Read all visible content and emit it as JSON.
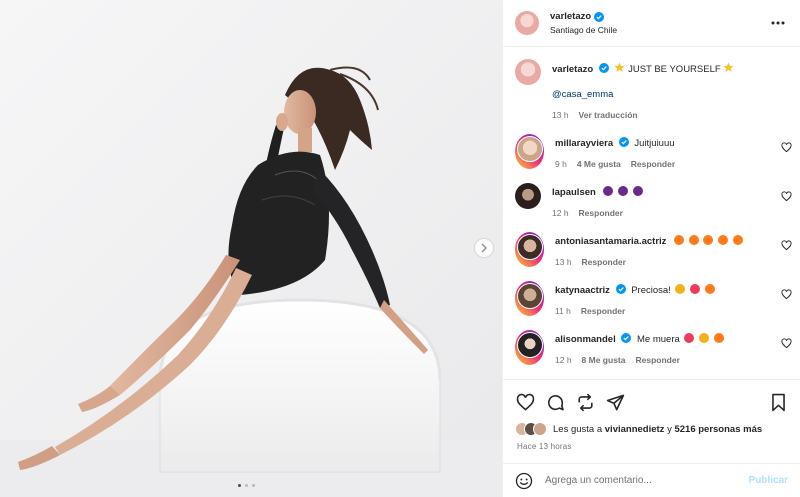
{
  "post": {
    "author": "varletazo",
    "location": "Santiago de Chile",
    "caption_text": "JUST BE YOURSELF",
    "mention": "@casa_emma",
    "caption_time": "13 h",
    "translate": "Ver traducción",
    "carousel": {
      "total": 3,
      "current": 1
    }
  },
  "comments": [
    {
      "user": "millarayviera",
      "verified": true,
      "text": "Juitjuiuuu",
      "time": "9 h",
      "likes": "4 Me gusta",
      "reply": "Responder",
      "avatar_color": "#e8c7a9"
    },
    {
      "user": "lapaulsen",
      "verified": false,
      "text": "",
      "emojis": [
        "eggplant",
        "eggplant",
        "eggplant"
      ],
      "time": "12 h",
      "likes": "",
      "reply": "Responder",
      "avatar_color": "#3b2b26"
    },
    {
      "user": "antoniasantamaria.actriz",
      "verified": false,
      "text": "",
      "emojis": [
        "fire",
        "fire",
        "fire",
        "fire",
        "fire"
      ],
      "time": "13 h",
      "likes": "",
      "reply": "Responder",
      "avatar_color": "#7a5a4e"
    },
    {
      "user": "katynaactriz",
      "verified": true,
      "text": "Preciosa!",
      "emojis": [
        "heart-eyes",
        "heart",
        "fire"
      ],
      "time": "11 h",
      "likes": "",
      "reply": "Responder",
      "avatar_color": "#6d5a48"
    },
    {
      "user": "alisonmandel",
      "verified": true,
      "text": "Me muera",
      "emojis": [
        "heart",
        "heart-eyes",
        "fire"
      ],
      "time": "12 h",
      "likes": "8 Me gusta",
      "reply": "Responder",
      "avatar_color": "#2f2a2a"
    }
  ],
  "footer": {
    "likes_prefix": "Les gusta a",
    "liked_by": "viviannedietz",
    "likes_joiner": "y",
    "likes_count": "5216 personas más",
    "time_ago": "Hace 13 horas",
    "comment_placeholder": "Agrega un comentario...",
    "publish_label": "Publicar"
  },
  "colors": {
    "verified": "#0095f6",
    "link": "#00376b",
    "publish_disabled": "#b2dffc",
    "meta": "#737373"
  },
  "icons": [
    "verified-icon",
    "more-options-icon",
    "heart-icon",
    "comment-icon",
    "share-icon",
    "send-icon",
    "bookmark-icon",
    "emoji-icon",
    "chevron-right-icon",
    "star-emoji-icon",
    "fire-emoji-icon",
    "heart-emoji-icon",
    "heart-eyes-emoji-icon",
    "eggplant-emoji-icon"
  ]
}
